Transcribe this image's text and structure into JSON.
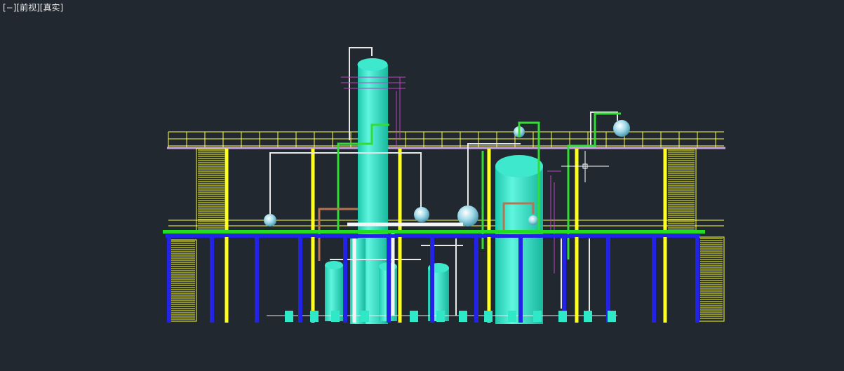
{
  "viewport": {
    "control_minimize": "[−]",
    "control_view": "[前视]",
    "control_style": "[真实]"
  },
  "colors": {
    "background": "#212830",
    "steel_blue": "#2323e6",
    "steel_yellow": "#ffff1e",
    "platform_green": "#22dd22",
    "pipe_white": "#e8e8e8",
    "pipe_green": "#33dd33",
    "pipe_copper": "#b87352",
    "vessel_teal": "#2ee8c8",
    "handrail_yellow": "#ffff40",
    "instrument_magenta": "#c040c0"
  },
  "model": {
    "name": "distillation-unit",
    "icons": [
      "column-icon",
      "tank-icon",
      "sphere-icon",
      "pump-icon",
      "stair-icon",
      "handrail-icon"
    ]
  }
}
